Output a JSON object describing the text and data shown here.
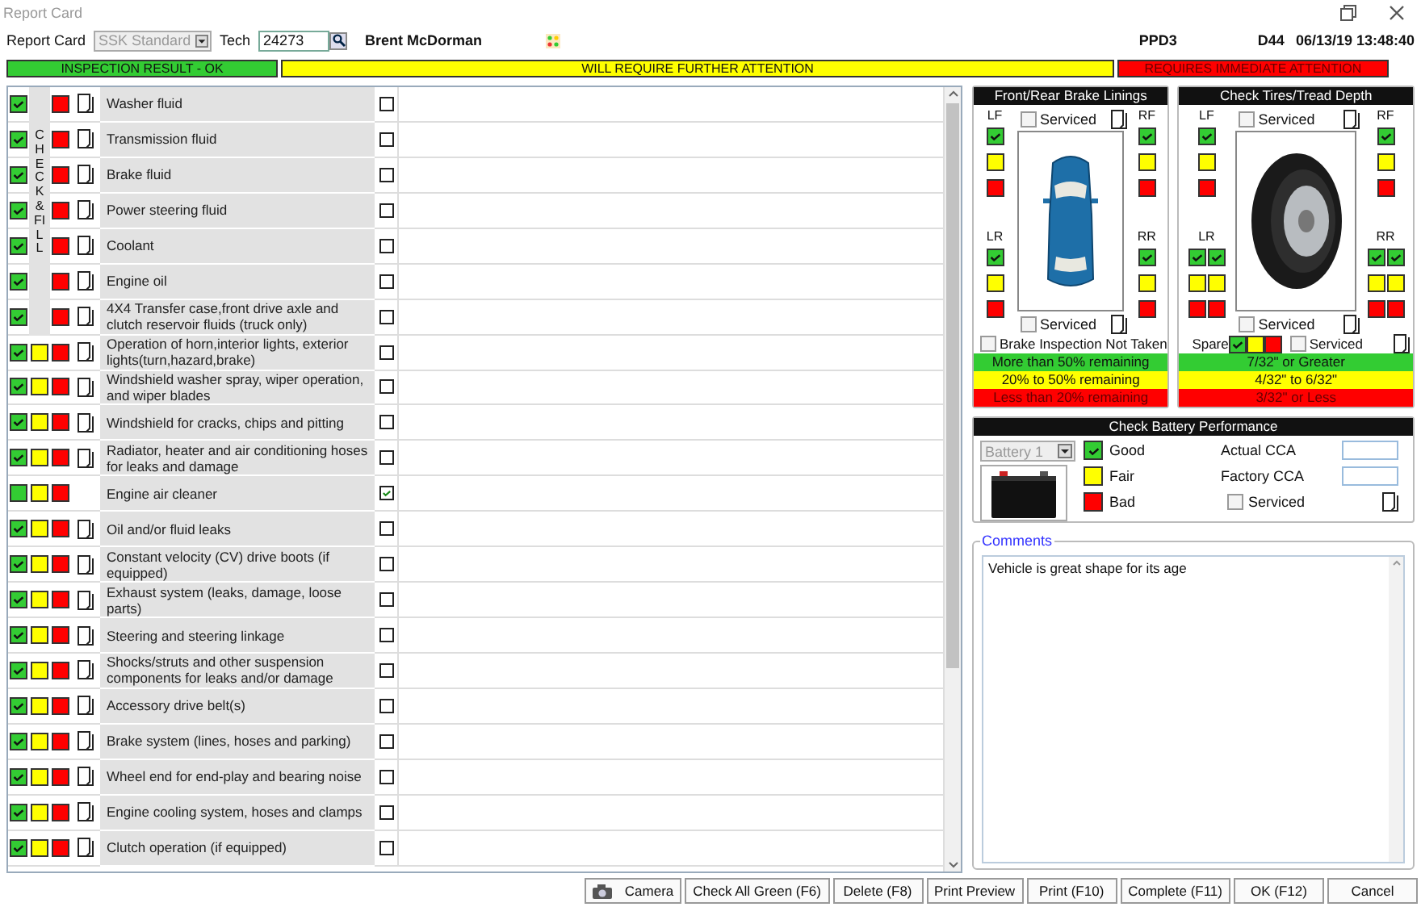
{
  "window": {
    "title": "Report Card"
  },
  "header": {
    "report_card_label": "Report Card",
    "report_card_select": {
      "value": "SSK Standard",
      "disabled": true
    },
    "tech_label": "Tech",
    "tech_value": "24273",
    "tech_name": "Brent McDorman",
    "code": "PPD3",
    "bay": "D44",
    "datetime": "06/13/19 13:48:40"
  },
  "legend": [
    {
      "label": "INSPECTION RESULT - OK",
      "color": "#33cc33"
    },
    {
      "label": "WILL REQUIRE FURTHER ATTENTION",
      "color": "#ffff00"
    },
    {
      "label": "REQUIRES IMMEDIATE ATTENTION",
      "color": "#ff0000"
    }
  ],
  "check_fill_label": "CHECK&FILL",
  "items": [
    {
      "label": "Washer fluid",
      "kind": "fluid",
      "ok": true,
      "note": true,
      "checked": false
    },
    {
      "label": "Transmission fluid",
      "kind": "fluid",
      "ok": true,
      "note": true,
      "checked": false
    },
    {
      "label": "Brake fluid",
      "kind": "fluid",
      "ok": true,
      "note": true,
      "checked": false
    },
    {
      "label": "Power steering fluid",
      "kind": "fluid",
      "ok": true,
      "note": true,
      "checked": false
    },
    {
      "label": "Coolant",
      "kind": "fluid",
      "ok": true,
      "note": true,
      "checked": false
    },
    {
      "label": "Engine oil",
      "kind": "fluid",
      "ok": true,
      "note": true,
      "checked": false
    },
    {
      "label": "4X4 Transfer case,front drive axle and clutch reservoir fluids (truck only)",
      "kind": "fluid",
      "ok": true,
      "note": true,
      "checked": false
    },
    {
      "label": "Operation of horn,interior lights, exterior lights(turn,hazard,brake)",
      "kind": "standard",
      "ok": true,
      "note": true,
      "checked": false
    },
    {
      "label": "Windshield washer spray, wiper operation, and wiper blades",
      "kind": "standard",
      "ok": true,
      "note": true,
      "checked": false
    },
    {
      "label": "Windshield for cracks, chips and pitting",
      "kind": "standard",
      "ok": true,
      "note": true,
      "checked": false
    },
    {
      "label": "Radiator, heater and air conditioning hoses for leaks and damage",
      "kind": "standard",
      "ok": true,
      "note": true,
      "checked": false
    },
    {
      "label": "Engine air cleaner",
      "kind": "standard",
      "ok": false,
      "note": false,
      "checked": true
    },
    {
      "label": "Oil and/or fluid leaks",
      "kind": "standard",
      "ok": true,
      "note": true,
      "checked": false
    },
    {
      "label": "Constant velocity (CV) drive boots (if equipped)",
      "kind": "standard",
      "ok": true,
      "note": true,
      "checked": false
    },
    {
      "label": "Exhaust system (leaks, damage, loose parts)",
      "kind": "standard",
      "ok": true,
      "note": true,
      "checked": false
    },
    {
      "label": "Steering and steering linkage",
      "kind": "standard",
      "ok": true,
      "note": true,
      "checked": false
    },
    {
      "label": "Shocks/struts and other suspension components for leaks and/or damage",
      "kind": "standard",
      "ok": true,
      "note": true,
      "checked": false
    },
    {
      "label": "Accessory drive belt(s)",
      "kind": "standard",
      "ok": true,
      "note": true,
      "checked": false
    },
    {
      "label": "Brake system (lines, hoses and parking)",
      "kind": "standard",
      "ok": true,
      "note": true,
      "checked": false
    },
    {
      "label": "Wheel end for end-play and bearing noise",
      "kind": "standard",
      "ok": true,
      "note": true,
      "checked": false
    },
    {
      "label": "Engine cooling system, hoses and clamps",
      "kind": "standard",
      "ok": true,
      "note": true,
      "checked": false
    },
    {
      "label": "Clutch operation (if equipped)",
      "kind": "standard",
      "ok": true,
      "note": true,
      "checked": false
    }
  ],
  "brakes": {
    "title": "Front/Rear Brake Linings",
    "serviced": [
      {
        "label": "Serviced",
        "checked": false
      },
      {
        "label": "Serviced",
        "checked": false
      }
    ],
    "positions": [
      {
        "label": "LF",
        "ok": true
      },
      {
        "label": "RF",
        "ok": true
      },
      {
        "label": "LR",
        "ok": true
      },
      {
        "label": "RR",
        "ok": true
      }
    ],
    "not_taken": {
      "label": "Brake Inspection Not Taken",
      "checked": false
    },
    "scale": [
      {
        "label": "More than 50% remaining",
        "color": "#33cc33"
      },
      {
        "label": "20% to 50% remaining",
        "color": "#ffff00"
      },
      {
        "label": "Less than 20% remaining",
        "color": "#ff0000"
      }
    ]
  },
  "tires": {
    "title": "Check Tires/Tread Depth",
    "serviced": [
      {
        "label": "Serviced",
        "checked": false
      },
      {
        "label": "Serviced",
        "checked": false
      }
    ],
    "positions": [
      {
        "label": "LF",
        "wheels": [
          true
        ]
      },
      {
        "label": "RF",
        "wheels": [
          true
        ]
      },
      {
        "label": "LR",
        "wheels": [
          true,
          true
        ]
      },
      {
        "label": "RR",
        "wheels": [
          true,
          true
        ]
      }
    ],
    "spare": {
      "label": "Spare",
      "ok": true,
      "serviced_label": "Serviced",
      "serviced": false
    },
    "scale": [
      {
        "label": "7/32\" or Greater",
        "color": "#33cc33"
      },
      {
        "label": "4/32\" to 6/32\"",
        "color": "#ffff00"
      },
      {
        "label": "3/32\" or Less",
        "color": "#ff0000"
      }
    ]
  },
  "battery": {
    "title": "Check Battery Performance",
    "select": {
      "value": "Battery 1",
      "disabled": true
    },
    "ratings": [
      {
        "label": "Good",
        "color": "#33cc33",
        "selected": true
      },
      {
        "label": "Fair",
        "color": "#ffff00",
        "selected": false
      },
      {
        "label": "Bad",
        "color": "#ff0000",
        "selected": false
      }
    ],
    "actual_cca_label": "Actual CCA",
    "factory_cca_label": "Factory CCA",
    "serviced_label": "Serviced",
    "serviced": false
  },
  "comments": {
    "title": "Comments",
    "value": "Vehicle is great shape for its age"
  },
  "buttons": [
    {
      "label": "Camera",
      "kind": "camera"
    },
    {
      "label": "Check All Green (F6)",
      "kind": "plain"
    },
    {
      "label": "Delete (F8)",
      "kind": "plain"
    },
    {
      "label": "Print Preview",
      "kind": "plain"
    },
    {
      "label": "Print (F10)",
      "kind": "plain"
    },
    {
      "label": "Complete (F11)",
      "kind": "plain"
    },
    {
      "label": "OK (F12)",
      "kind": "plain"
    },
    {
      "label": "Cancel",
      "kind": "plain"
    }
  ]
}
